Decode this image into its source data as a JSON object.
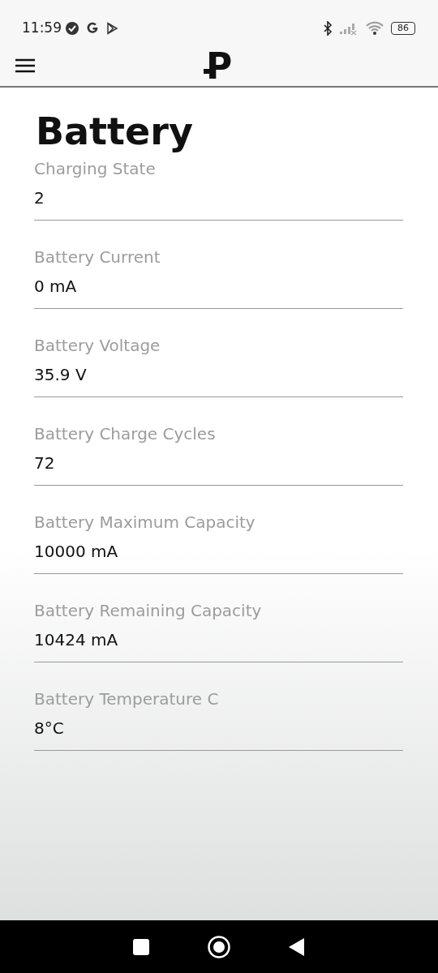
{
  "status_bar": {
    "time": "11:59",
    "battery": "86"
  },
  "header": {
    "logo": "P"
  },
  "title": "Battery",
  "fields": [
    {
      "label": "Charging State",
      "value": "2"
    },
    {
      "label": "Battery Current",
      "value": "0 mA"
    },
    {
      "label": "Battery Voltage",
      "value": "35.9 V"
    },
    {
      "label": "Battery Charge Cycles",
      "value": "72"
    },
    {
      "label": "Battery Maximum Capacity",
      "value": "10000 mA"
    },
    {
      "label": "Battery Remaining Capacity",
      "value": "10424 mA"
    },
    {
      "label": "Battery Temperature C",
      "value": "8°C"
    }
  ]
}
